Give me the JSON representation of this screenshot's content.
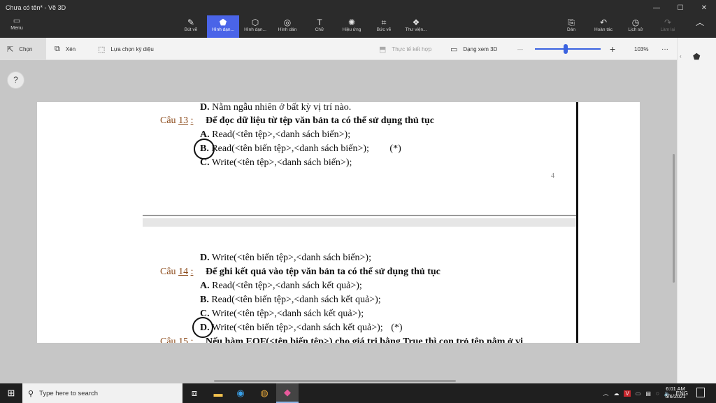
{
  "window": {
    "title": "Chưa có tên* - Vẽ 3D",
    "controls": [
      "—",
      "☐",
      "✕"
    ]
  },
  "ribbon": {
    "menu": {
      "icon": "▭",
      "label": "Menu"
    },
    "tools": [
      {
        "icon": "✎",
        "label": "Bút vẽ"
      },
      {
        "icon": "⬟",
        "label": "Hình dạn..."
      },
      {
        "icon": "⬡",
        "label": "Hình dạn..."
      },
      {
        "icon": "◎",
        "label": "Hình dán"
      },
      {
        "icon": "T",
        "label": "Chữ"
      },
      {
        "icon": "✺",
        "label": "Hiệu ứng"
      },
      {
        "icon": "⌗",
        "label": "Bức vẽ"
      },
      {
        "icon": "❖",
        "label": "Thư viện..."
      }
    ],
    "right_tools": [
      {
        "icon": "⎘",
        "label": "Dán"
      },
      {
        "icon": "↶",
        "label": "Hoàn tác"
      },
      {
        "icon": "◷",
        "label": "Lịch sử"
      },
      {
        "icon": "↷",
        "label": "Làm lại"
      }
    ],
    "collapse_icon": "︿"
  },
  "toolbar": {
    "select": {
      "icon": "⇱",
      "label": "Chọn"
    },
    "crop": {
      "icon": "⧉",
      "label": "Xén"
    },
    "magic": {
      "icon": "⬚",
      "label": "Lựa chọn kỳ diệu"
    },
    "mixed_reality": {
      "icon": "⬒",
      "label": "Thực tế kết hợp"
    },
    "view3d": {
      "icon": "▭",
      "label": "Dạng xem 3D"
    },
    "zoom_out": "—",
    "zoom_in": "+",
    "zoom": "103%",
    "more": "···",
    "zoom_level": 0.47
  },
  "side_panel": {
    "pin": "‹",
    "icon": "⬟"
  },
  "help": "?",
  "document": {
    "page_number": "4",
    "q13": {
      "prev_option": [
        "D.",
        "Nằm ngẫu nhiên ở bất kỳ vị trí nào."
      ],
      "label_word": "Câu",
      "number": "13",
      "colon": ":",
      "question": "Để đọc dữ liệu từ tệp văn bản ta có thể sử dụng thủ tục",
      "options": [
        {
          "letter": "A.",
          "text": "Read(<tên tệp>,<danh sách biến>);"
        },
        {
          "letter": "B.",
          "text": "Read(<tên biến tệp>,<danh sách biến>);",
          "mark": "(*)"
        },
        {
          "letter": "C.",
          "text": "Write(<tên tệp>,<danh sách biến>);"
        }
      ]
    },
    "q14": {
      "prev_option": [
        "D.",
        "Write(<tên biến tệp>,<danh sách biến>);"
      ],
      "label_word": "Câu",
      "number": "14",
      "colon": ":",
      "question": "Để ghi kết quả vào tệp văn bản ta có thể sử dụng thủ tục",
      "options": [
        {
          "letter": "A.",
          "text": "Read(<tên tệp>,<danh sách kết quả>);"
        },
        {
          "letter": "B.",
          "text": "Read(<tên biến tệp>,<danh sách kết quả>);"
        },
        {
          "letter": "C.",
          "text": "Write(<tên tệp>,<danh sách kết quả>);"
        },
        {
          "letter": "D.",
          "text": "Write(<tên biến tệp>,<danh sách kết quả>);",
          "mark": "(*)"
        }
      ]
    },
    "q15": {
      "label_word": "Câu",
      "number": "15",
      "colon": ":",
      "question": "Nếu hàm EOF(<tên biến tệp>) cho giá trị bằng True thì con trỏ tệp nằm ở vị"
    }
  },
  "taskbar": {
    "start_icon": "⊞",
    "search_icon": "⚲",
    "search_placeholder": "Type here to search",
    "apps": [
      {
        "icon": "⧈",
        "name": "task-view"
      },
      {
        "icon": "▬",
        "name": "file-explorer"
      },
      {
        "icon": "◉",
        "name": "edge"
      },
      {
        "icon": "◍",
        "name": "chrome"
      },
      {
        "icon": "◆",
        "name": "paint-3d"
      }
    ],
    "tray": [
      "︿",
      "☁",
      "V",
      "▭",
      "▤",
      "◌",
      "🔈",
      "ENG"
    ],
    "time": "6:01 AM",
    "date": "5/6/2021"
  },
  "colors": {
    "accent": "#4a64e8",
    "titlebar": "#2b2b2b",
    "question_label": "#8b4a1a"
  }
}
